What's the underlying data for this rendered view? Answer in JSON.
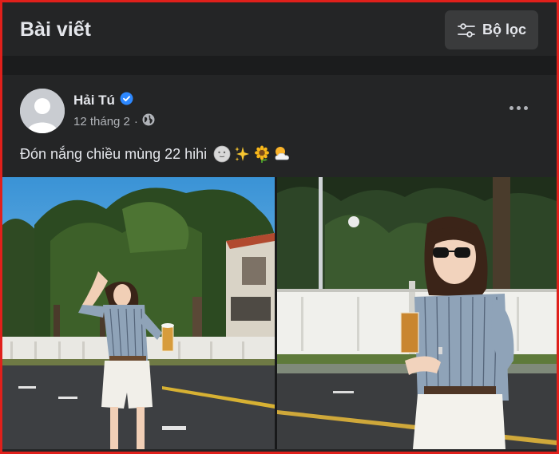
{
  "header": {
    "title": "Bài viết",
    "filter_label": "Bộ lọc",
    "filter_icon": "sliders-icon"
  },
  "post": {
    "author": "Hải Tú",
    "verified_icon": "verified-badge-icon",
    "date": "12 tháng 2",
    "separator": "·",
    "audience_icon": "globe-icon",
    "more_icon": "more-horizontal-icon",
    "caption_text": "Đón nắng chiều mùng 22 hihi",
    "caption_emojis": [
      "moon-face-icon",
      "sparkles-icon",
      "sunflower-icon",
      "sun-behind-cloud-icon"
    ],
    "photos": [
      "photo-street-waving",
      "photo-street-sunglasses"
    ]
  },
  "colors": {
    "background": "#18191a",
    "card": "#242526",
    "button": "#3a3b3c",
    "text_primary": "#e4e6eb",
    "text_secondary": "#b0b3b8",
    "verified": "#2d88ff",
    "frame_border": "#e0201b"
  }
}
